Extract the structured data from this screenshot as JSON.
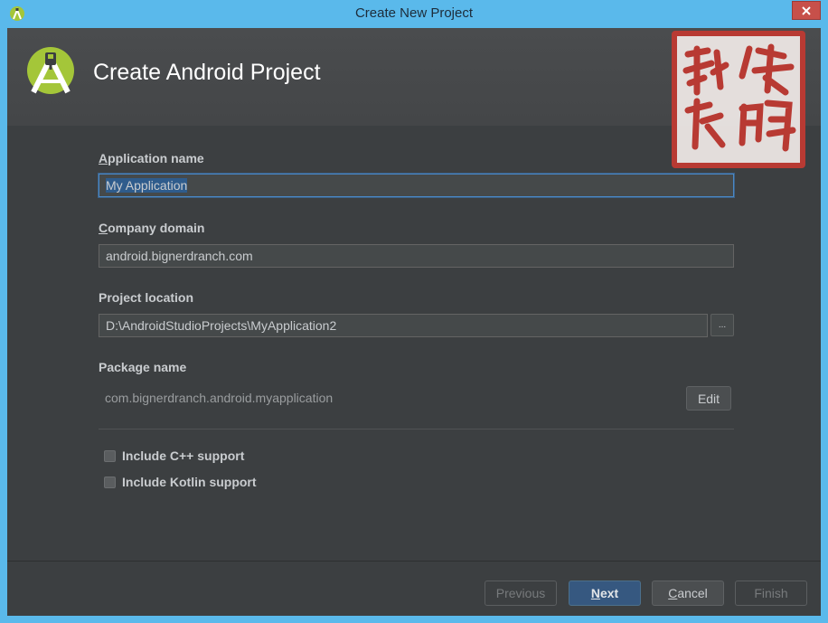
{
  "window": {
    "title": "Create New Project"
  },
  "header": {
    "title": "Create Android Project"
  },
  "seal": {
    "text": "刘依 作鹏"
  },
  "form": {
    "app_name": {
      "mnemonic": "A",
      "label_rest": "pplication name",
      "value": "My Application"
    },
    "company_domain": {
      "mnemonic": "C",
      "label_rest": "ompany domain",
      "value": "android.bignerdranch.com"
    },
    "project_location": {
      "label": "Project location",
      "value": "D:\\AndroidStudioProjects\\MyApplication2",
      "browse_label": "..."
    },
    "package_name": {
      "label": "Package name",
      "value": "com.bignerdranch.android.myapplication",
      "edit_label": "Edit"
    }
  },
  "options": [
    {
      "label": "Include C++ support",
      "checked": false
    },
    {
      "label": "Include Kotlin support",
      "checked": false
    }
  ],
  "footer": {
    "previous": "Previous",
    "next_mn": "N",
    "next_rest": "ext",
    "cancel_mn": "C",
    "cancel_rest": "ancel",
    "finish": "Finish"
  },
  "colors": {
    "accent": "#4a88c7",
    "primary_button": "#365880",
    "dialog_bg": "#3c3f41",
    "title_bar": "#5ab9eb",
    "android_green": "#a4c639"
  },
  "icons": [
    "android-studio-icon",
    "close-icon",
    "android-studio-logo-icon"
  ]
}
